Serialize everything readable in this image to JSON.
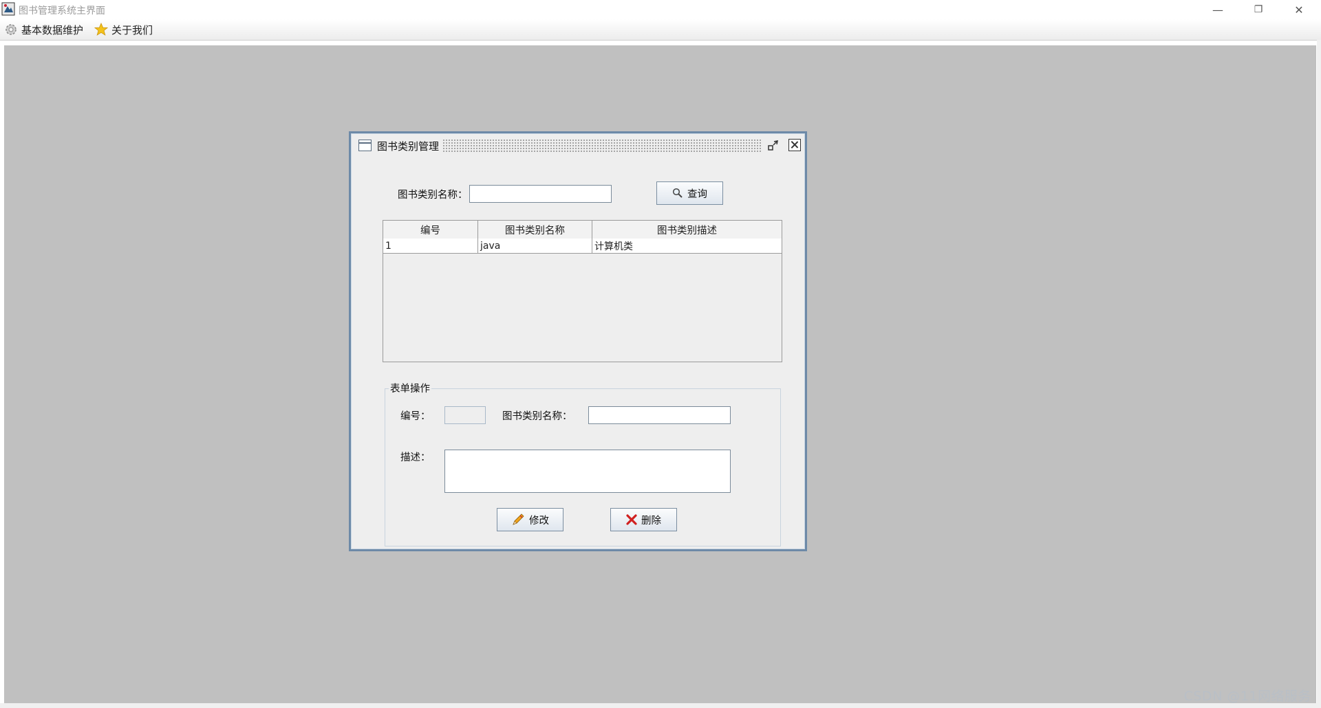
{
  "window": {
    "title": "图书管理系统主界面",
    "controls": {
      "minimize": "—",
      "restore": "❐",
      "close": "✕"
    }
  },
  "menubar": {
    "items": [
      {
        "label": "基本数据维护",
        "icon": "gear-icon"
      },
      {
        "label": "关于我们",
        "icon": "star-icon"
      }
    ]
  },
  "frame": {
    "title": "图书类别管理",
    "search": {
      "label": "图书类别名称：",
      "value": "",
      "button_label": "查询",
      "button_icon": "search-icon"
    },
    "table": {
      "columns": [
        "编号",
        "图书类别名称",
        "图书类别描述"
      ],
      "rows": [
        [
          "1",
          "java",
          "计算机类"
        ]
      ]
    },
    "form": {
      "legend": "表单操作",
      "id_label": "编号：",
      "id_value": "",
      "name_label": "图书类别名称：",
      "name_value": "",
      "desc_label": "描述：",
      "desc_value": "",
      "modify_label": "修改",
      "modify_icon": "pencil-icon",
      "delete_label": "删除",
      "delete_icon": "red-x-icon"
    }
  },
  "watermark": "CSDN @11网络服务",
  "colors": {
    "desktop": "#c0c0c0",
    "frame_border": "#6d8aa8",
    "panel": "#eeeeee",
    "delete_red": "#d02020",
    "star_yellow": "#f4c21a"
  }
}
